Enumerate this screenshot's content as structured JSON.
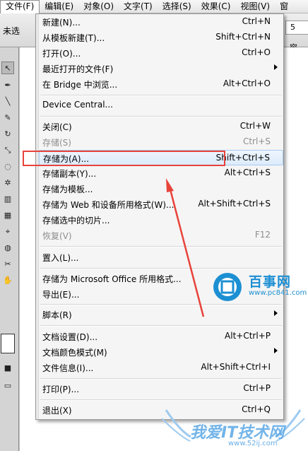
{
  "menubar": {
    "items": [
      "文件(F)",
      "编辑(E)",
      "对象(O)",
      "文字(T)",
      "选择(S)",
      "效果(C)",
      "视图(V)",
      "窗"
    ]
  },
  "controlbar": {
    "left_label": "未选",
    "field_value": "5",
    "right_label": "容"
  },
  "file_menu": {
    "items": [
      {
        "label": "新建(N)...",
        "shortcut": "Ctrl+N"
      },
      {
        "label": "从模板新建(T)...",
        "shortcut": "Shift+Ctrl+N"
      },
      {
        "label": "打开(O)...",
        "shortcut": "Ctrl+O"
      },
      {
        "label": "最近打开的文件(F)",
        "shortcut": ""
      },
      {
        "label": "在 Bridge 中浏览...",
        "shortcut": "Alt+Ctrl+O"
      },
      {
        "label": "Device Central...",
        "shortcut": ""
      },
      {
        "label": "关闭(C)",
        "shortcut": "Ctrl+W"
      },
      {
        "label": "存储(S)",
        "shortcut": "Ctrl+S"
      },
      {
        "label": "存储为(A)...",
        "shortcut": "Shift+Ctrl+S"
      },
      {
        "label": "存储副本(Y)...",
        "shortcut": "Alt+Ctrl+S"
      },
      {
        "label": "存储为模板...",
        "shortcut": ""
      },
      {
        "label": "存储为 Web 和设备所用格式(W)...",
        "shortcut": "Alt+Shift+Ctrl+S"
      },
      {
        "label": "存储选中的切片...",
        "shortcut": ""
      },
      {
        "label": "恢复(V)",
        "shortcut": "F12"
      },
      {
        "label": "置入(L)...",
        "shortcut": ""
      },
      {
        "label": "存储为 Microsoft Office 所用格式...",
        "shortcut": ""
      },
      {
        "label": "导出(E)...",
        "shortcut": ""
      },
      {
        "label": "脚本(R)",
        "shortcut": ""
      },
      {
        "label": "文档设置(D)...",
        "shortcut": "Alt+Ctrl+P"
      },
      {
        "label": "文档颜色模式(M)",
        "shortcut": ""
      },
      {
        "label": "文件信息(I)...",
        "shortcut": "Alt+Shift+Ctrl+I"
      },
      {
        "label": "打印(P)...",
        "shortcut": "Ctrl+P"
      },
      {
        "label": "退出(X)",
        "shortcut": "Ctrl+Q"
      }
    ]
  },
  "watermarks": {
    "logo_text": "百事网",
    "logo_url": "www.pc841.com",
    "bottom_text": "我爱IT技术网",
    "bottom_url": "www.52ij.com"
  },
  "colors": {
    "highlight": "#e8433a",
    "watermark_blue": "#1c8fd3"
  }
}
